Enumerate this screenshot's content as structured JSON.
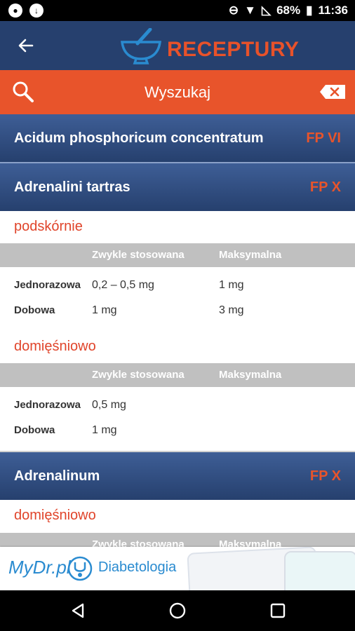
{
  "status_bar": {
    "battery": "68%",
    "time": "11:36"
  },
  "app_bar": {
    "title": "RECEPTURY"
  },
  "search": {
    "label": "Wyszukaj"
  },
  "table_headers": {
    "usual": "Zwykle stosowana",
    "max": "Maksymalna"
  },
  "entries": [
    {
      "name": "Acidum phosphoricum concentratum",
      "fp": "FP VI"
    },
    {
      "name": "Adrenalini tartras",
      "fp": "FP X",
      "routes": [
        {
          "route": "podskórnie",
          "rows": [
            {
              "label": "Jednorazowa",
              "usual": "0,2 – 0,5 mg",
              "max": "1 mg"
            },
            {
              "label": "Dobowa",
              "usual": "1 mg",
              "max": "3 mg"
            }
          ]
        },
        {
          "route": "domięśniowo",
          "rows": [
            {
              "label": "Jednorazowa",
              "usual": "0,5 mg",
              "max": ""
            },
            {
              "label": "Dobowa",
              "usual": "1 mg",
              "max": ""
            }
          ]
        }
      ]
    },
    {
      "name": "Adrenalinum",
      "fp": "FP X",
      "routes": [
        {
          "route": "domięśniowo"
        }
      ]
    }
  ],
  "ad": {
    "brand": "MyDr.pl",
    "title": "Diabetologia"
  }
}
